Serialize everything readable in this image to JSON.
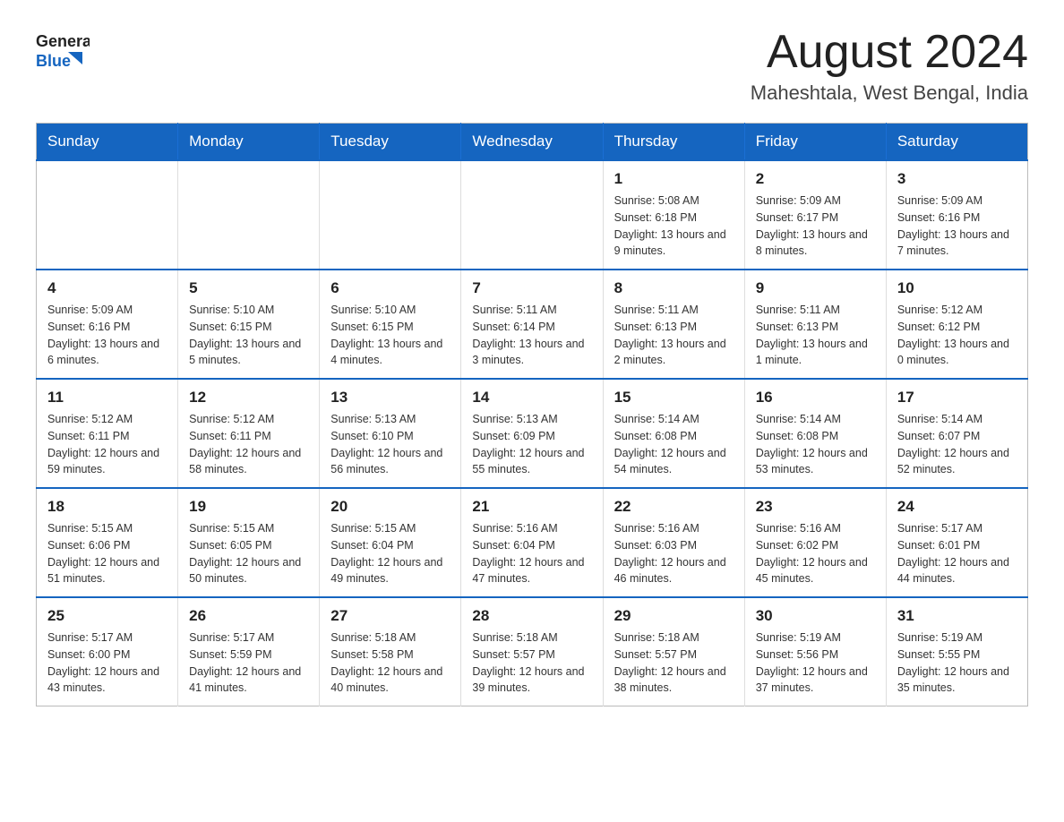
{
  "header": {
    "logo_general": "General",
    "logo_blue": "Blue",
    "month_title": "August 2024",
    "location": "Maheshtala, West Bengal, India"
  },
  "weekdays": [
    "Sunday",
    "Monday",
    "Tuesday",
    "Wednesday",
    "Thursday",
    "Friday",
    "Saturday"
  ],
  "weeks": [
    [
      {
        "day": "",
        "info": ""
      },
      {
        "day": "",
        "info": ""
      },
      {
        "day": "",
        "info": ""
      },
      {
        "day": "",
        "info": ""
      },
      {
        "day": "1",
        "info": "Sunrise: 5:08 AM\nSunset: 6:18 PM\nDaylight: 13 hours and 9 minutes."
      },
      {
        "day": "2",
        "info": "Sunrise: 5:09 AM\nSunset: 6:17 PM\nDaylight: 13 hours and 8 minutes."
      },
      {
        "day": "3",
        "info": "Sunrise: 5:09 AM\nSunset: 6:16 PM\nDaylight: 13 hours and 7 minutes."
      }
    ],
    [
      {
        "day": "4",
        "info": "Sunrise: 5:09 AM\nSunset: 6:16 PM\nDaylight: 13 hours and 6 minutes."
      },
      {
        "day": "5",
        "info": "Sunrise: 5:10 AM\nSunset: 6:15 PM\nDaylight: 13 hours and 5 minutes."
      },
      {
        "day": "6",
        "info": "Sunrise: 5:10 AM\nSunset: 6:15 PM\nDaylight: 13 hours and 4 minutes."
      },
      {
        "day": "7",
        "info": "Sunrise: 5:11 AM\nSunset: 6:14 PM\nDaylight: 13 hours and 3 minutes."
      },
      {
        "day": "8",
        "info": "Sunrise: 5:11 AM\nSunset: 6:13 PM\nDaylight: 13 hours and 2 minutes."
      },
      {
        "day": "9",
        "info": "Sunrise: 5:11 AM\nSunset: 6:13 PM\nDaylight: 13 hours and 1 minute."
      },
      {
        "day": "10",
        "info": "Sunrise: 5:12 AM\nSunset: 6:12 PM\nDaylight: 13 hours and 0 minutes."
      }
    ],
    [
      {
        "day": "11",
        "info": "Sunrise: 5:12 AM\nSunset: 6:11 PM\nDaylight: 12 hours and 59 minutes."
      },
      {
        "day": "12",
        "info": "Sunrise: 5:12 AM\nSunset: 6:11 PM\nDaylight: 12 hours and 58 minutes."
      },
      {
        "day": "13",
        "info": "Sunrise: 5:13 AM\nSunset: 6:10 PM\nDaylight: 12 hours and 56 minutes."
      },
      {
        "day": "14",
        "info": "Sunrise: 5:13 AM\nSunset: 6:09 PM\nDaylight: 12 hours and 55 minutes."
      },
      {
        "day": "15",
        "info": "Sunrise: 5:14 AM\nSunset: 6:08 PM\nDaylight: 12 hours and 54 minutes."
      },
      {
        "day": "16",
        "info": "Sunrise: 5:14 AM\nSunset: 6:08 PM\nDaylight: 12 hours and 53 minutes."
      },
      {
        "day": "17",
        "info": "Sunrise: 5:14 AM\nSunset: 6:07 PM\nDaylight: 12 hours and 52 minutes."
      }
    ],
    [
      {
        "day": "18",
        "info": "Sunrise: 5:15 AM\nSunset: 6:06 PM\nDaylight: 12 hours and 51 minutes."
      },
      {
        "day": "19",
        "info": "Sunrise: 5:15 AM\nSunset: 6:05 PM\nDaylight: 12 hours and 50 minutes."
      },
      {
        "day": "20",
        "info": "Sunrise: 5:15 AM\nSunset: 6:04 PM\nDaylight: 12 hours and 49 minutes."
      },
      {
        "day": "21",
        "info": "Sunrise: 5:16 AM\nSunset: 6:04 PM\nDaylight: 12 hours and 47 minutes."
      },
      {
        "day": "22",
        "info": "Sunrise: 5:16 AM\nSunset: 6:03 PM\nDaylight: 12 hours and 46 minutes."
      },
      {
        "day": "23",
        "info": "Sunrise: 5:16 AM\nSunset: 6:02 PM\nDaylight: 12 hours and 45 minutes."
      },
      {
        "day": "24",
        "info": "Sunrise: 5:17 AM\nSunset: 6:01 PM\nDaylight: 12 hours and 44 minutes."
      }
    ],
    [
      {
        "day": "25",
        "info": "Sunrise: 5:17 AM\nSunset: 6:00 PM\nDaylight: 12 hours and 43 minutes."
      },
      {
        "day": "26",
        "info": "Sunrise: 5:17 AM\nSunset: 5:59 PM\nDaylight: 12 hours and 41 minutes."
      },
      {
        "day": "27",
        "info": "Sunrise: 5:18 AM\nSunset: 5:58 PM\nDaylight: 12 hours and 40 minutes."
      },
      {
        "day": "28",
        "info": "Sunrise: 5:18 AM\nSunset: 5:57 PM\nDaylight: 12 hours and 39 minutes."
      },
      {
        "day": "29",
        "info": "Sunrise: 5:18 AM\nSunset: 5:57 PM\nDaylight: 12 hours and 38 minutes."
      },
      {
        "day": "30",
        "info": "Sunrise: 5:19 AM\nSunset: 5:56 PM\nDaylight: 12 hours and 37 minutes."
      },
      {
        "day": "31",
        "info": "Sunrise: 5:19 AM\nSunset: 5:55 PM\nDaylight: 12 hours and 35 minutes."
      }
    ]
  ]
}
